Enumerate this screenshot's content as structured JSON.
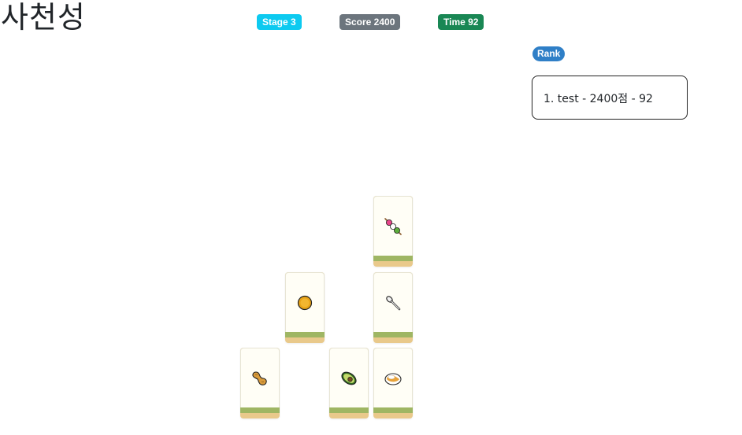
{
  "game": {
    "title": "사천성",
    "stage_label": "Stage 3",
    "score_label": "Score 2400",
    "time_label": "Time 92"
  },
  "rank": {
    "label": "Rank",
    "entries": [
      "1. test - 2400점 - 92"
    ]
  },
  "tiles": [
    {
      "icon": "dango-icon"
    },
    {
      "icon": "coin-icon"
    },
    {
      "icon": "spoon-icon"
    },
    {
      "icon": "peanut-icon"
    },
    {
      "icon": "avocado-icon"
    },
    {
      "icon": "curry-icon"
    }
  ],
  "colors": {
    "stage_badge": "#0dcaf0",
    "score_badge": "#6c757d",
    "time_badge": "#198754",
    "rank_badge": "#2f7fc7",
    "tile_face": "#fffef6",
    "tile_stripe": "#9fb663",
    "tile_base": "#e9c98b"
  }
}
